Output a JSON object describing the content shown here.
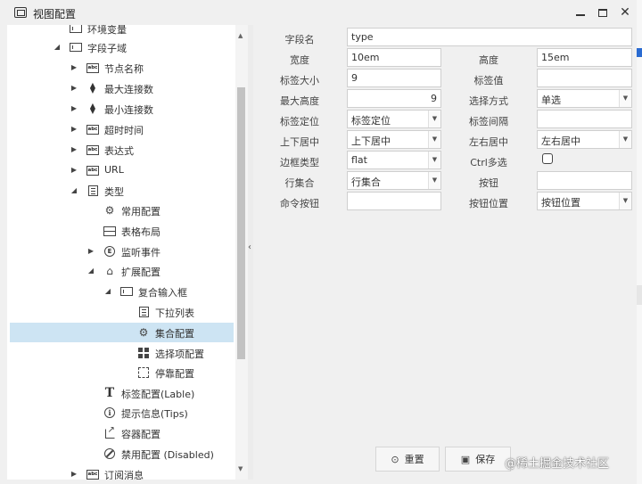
{
  "window": {
    "title": "视图配置"
  },
  "tree": {
    "items": [
      {
        "label": "环境变量",
        "icon": "input-box-icon",
        "arrow": "",
        "clipped": true
      },
      {
        "label": "字段子域",
        "icon": "input-box-icon",
        "arrow": "expanded"
      },
      {
        "label": "节点名称",
        "icon": "abc-icon",
        "arrow": "collapsed"
      },
      {
        "label": "最大连接数",
        "icon": "up-down-icon",
        "arrow": "collapsed"
      },
      {
        "label": "最小连接数",
        "icon": "up-down-icon",
        "arrow": "collapsed"
      },
      {
        "label": "超时时间",
        "icon": "abc-icon",
        "arrow": "collapsed"
      },
      {
        "label": "表达式",
        "icon": "abc-icon",
        "arrow": "collapsed"
      },
      {
        "label": "URL",
        "icon": "abc-icon",
        "arrow": "collapsed"
      },
      {
        "label": "类型",
        "icon": "list-doc-icon",
        "arrow": "expanded"
      },
      {
        "label": "常用配置",
        "icon": "gears-icon",
        "arrow": ""
      },
      {
        "label": "表格布局",
        "icon": "layout-icon",
        "arrow": ""
      },
      {
        "label": "监听事件",
        "icon": "circle-e-icon",
        "arrow": "collapsed"
      },
      {
        "label": "扩展配置",
        "icon": "puzzle-icon",
        "arrow": "expanded"
      },
      {
        "label": "复合输入框",
        "icon": "input-box-icon",
        "arrow": "expanded"
      },
      {
        "label": "下拉列表",
        "icon": "list-doc-icon",
        "arrow": ""
      },
      {
        "label": "集合配置",
        "icon": "gear-icon",
        "arrow": "",
        "selected": true
      },
      {
        "label": "选择项配置",
        "icon": "grid-icon",
        "arrow": ""
      },
      {
        "label": "停靠配置",
        "icon": "dashed-box-icon",
        "arrow": ""
      },
      {
        "label": "标签配置(Lable)",
        "icon": "text-t-icon",
        "arrow": ""
      },
      {
        "label": "提示信息(Tips)",
        "icon": "info-icon",
        "arrow": ""
      },
      {
        "label": "容器配置",
        "icon": "export-icon",
        "arrow": ""
      },
      {
        "label": "禁用配置 (Disabled)",
        "icon": "ban-icon",
        "arrow": ""
      },
      {
        "label": "订阅消息",
        "icon": "abc-icon",
        "arrow": "collapsed",
        "clipped": true
      }
    ]
  },
  "form": {
    "field_name": {
      "label": "字段名",
      "value": "type"
    },
    "width": {
      "label": "宽度",
      "value": "10em"
    },
    "height": {
      "label": "高度",
      "value": "15em"
    },
    "label_size": {
      "label": "标签大小",
      "value": "9"
    },
    "label_value": {
      "label": "标签值",
      "value": ""
    },
    "max_height": {
      "label": "最大高度",
      "value": "9"
    },
    "select_mode": {
      "label": "选择方式",
      "value": "单选"
    },
    "label_position": {
      "label": "标签定位",
      "value": "标签定位"
    },
    "label_spacing": {
      "label": "标签间隔",
      "value": ""
    },
    "valign": {
      "label": "上下居中",
      "value": "上下居中"
    },
    "halign": {
      "label": "左右居中",
      "value": "左右居中"
    },
    "border_type": {
      "label": "边框类型",
      "value": "flat"
    },
    "ctrl_multi": {
      "label": "Ctrl多选",
      "checked": false
    },
    "row_set": {
      "label": "行集合",
      "value": "行集合"
    },
    "button": {
      "label": "按钮",
      "value": ""
    },
    "command_button": {
      "label": "命令按钮",
      "value": ""
    },
    "button_position": {
      "label": "按钮位置",
      "value": "按钮位置"
    }
  },
  "actions": {
    "reset_label": "重置",
    "save_label": "保存"
  },
  "watermark": "@稀土掘金技术社区"
}
